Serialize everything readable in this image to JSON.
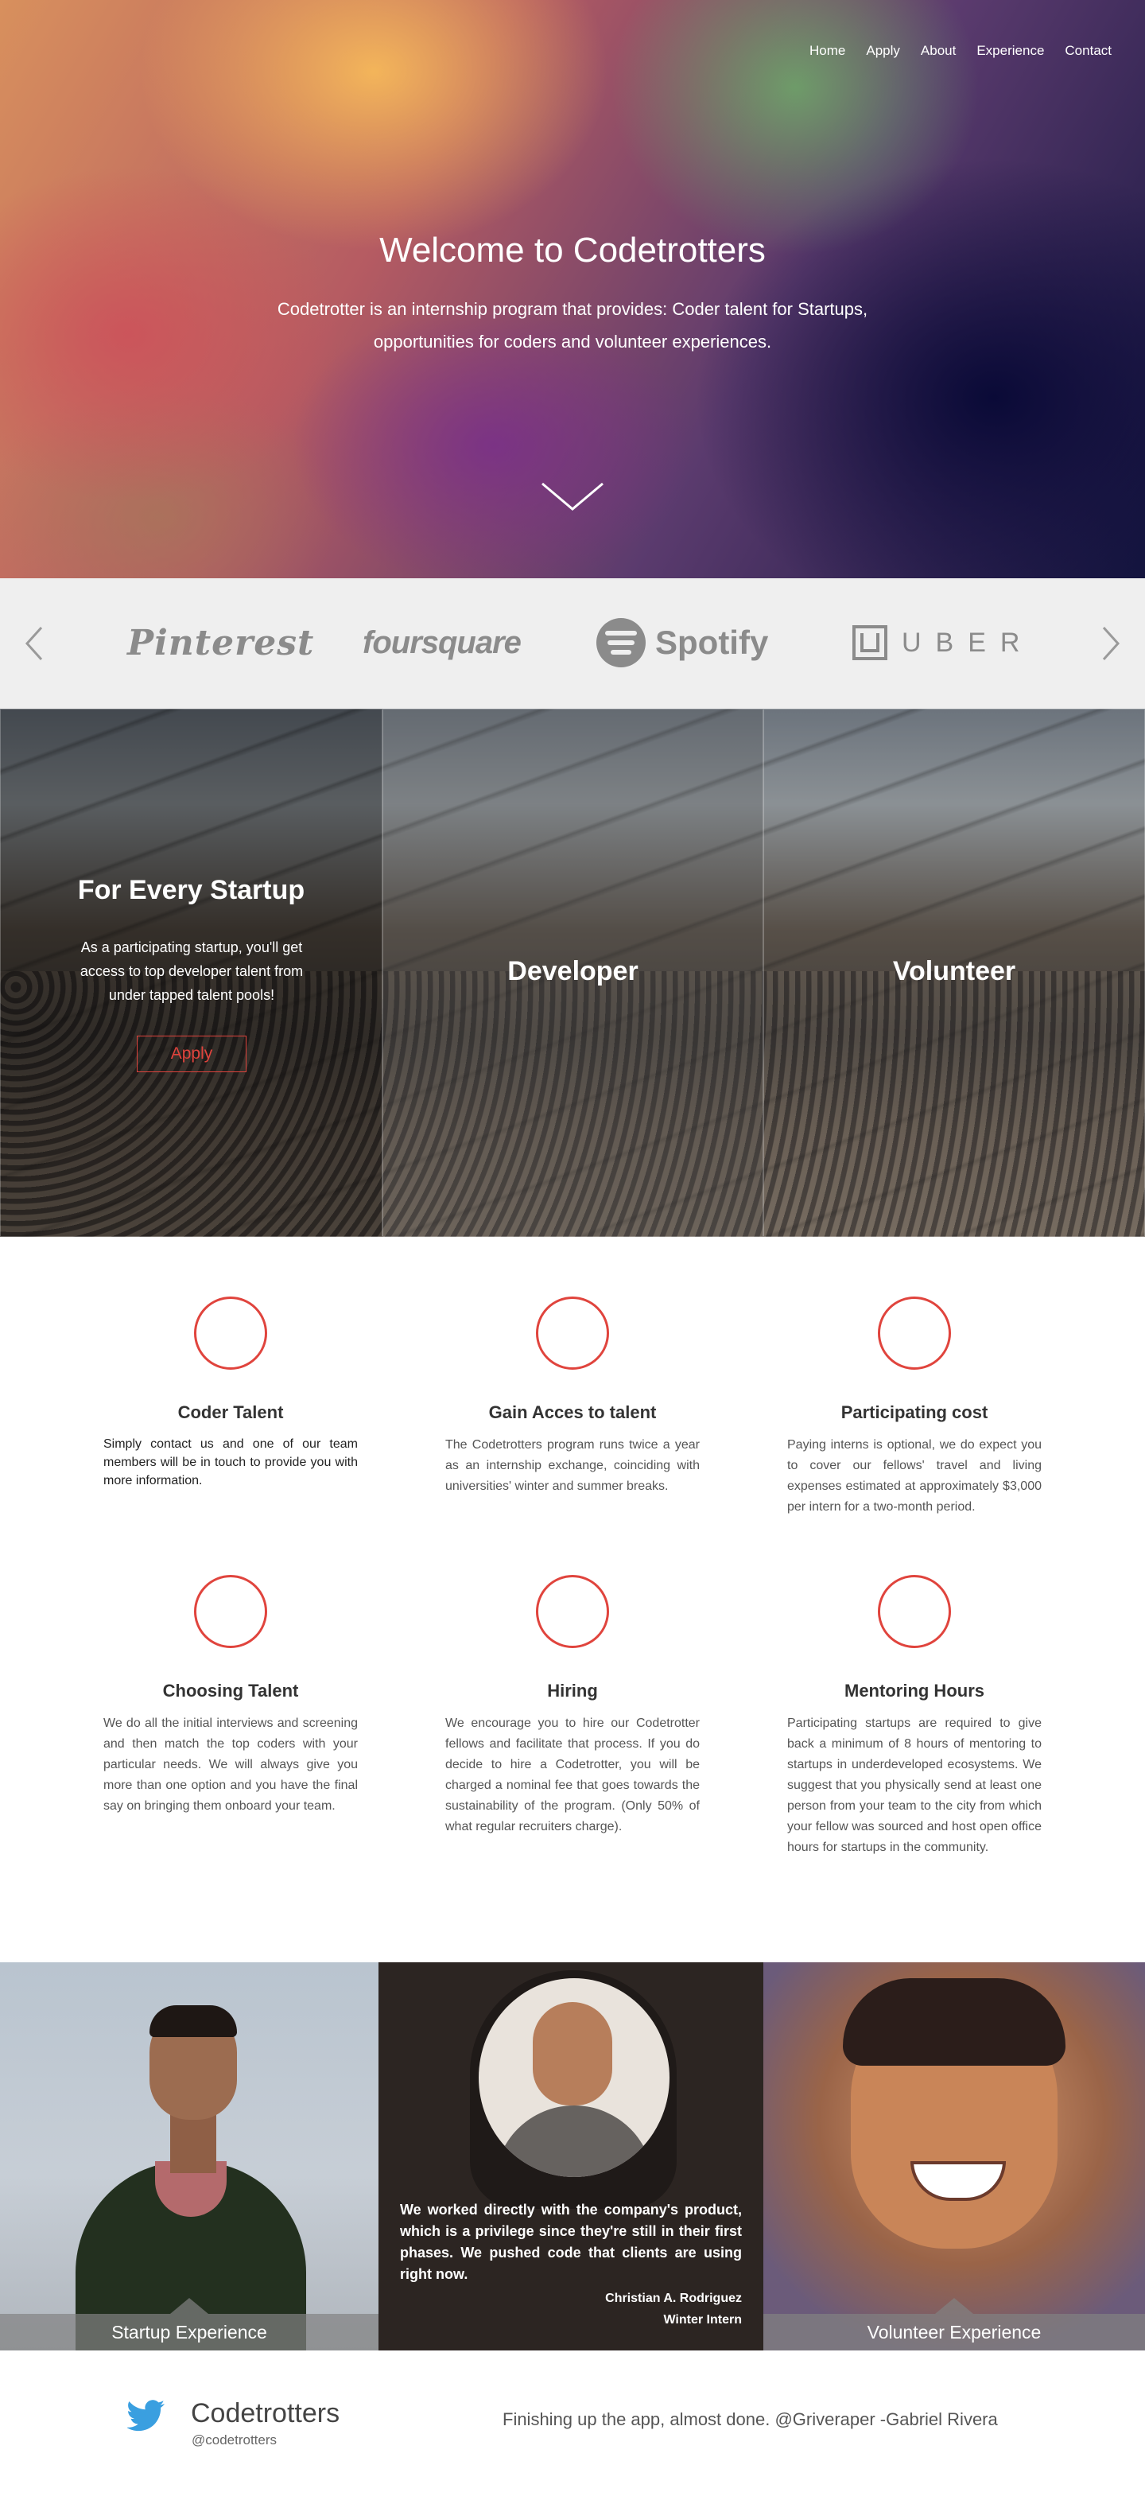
{
  "nav": {
    "items": [
      "Home",
      "Apply",
      "About",
      "Experience",
      "Contact"
    ]
  },
  "hero": {
    "title": "Welcome to Codetrotters",
    "subtitle": "Codetrotter is an internship program that provides: Coder talent for Startups, opportunities for coders and volunteer experiences."
  },
  "logos": {
    "pinterest": "Pinterest",
    "foursquare": "foursquare",
    "spotify": "Spotify",
    "uber": "UBER"
  },
  "panels": {
    "startup": {
      "title": "For Every Startup",
      "text": "As a participating startup, you'll get access to top developer talent from under tapped talent pools!",
      "button": "Apply"
    },
    "developer": {
      "title": "Developer"
    },
    "volunteer": {
      "title": "Volunteer"
    }
  },
  "features": [
    {
      "title": "Coder Talent",
      "text": "Simply contact us and one of our team members will be in touch to provide you with more information."
    },
    {
      "title": "Gain Acces to talent",
      "text": "The Codetrotters program runs twice a year as an internship exchange, coinciding with universities' winter and summer breaks."
    },
    {
      "title": "Participating cost",
      "text": "Paying interns is optional, we do expect you to cover our fellows' travel and living expenses estimated at approximately $3,000 per intern for a two-month period."
    },
    {
      "title": "Choosing Talent",
      "text": "We do all the initial interviews and screening and then match the top coders with your particular needs. We will always give you more than one option and you have the final say on bringing them onboard your team."
    },
    {
      "title": "Hiring",
      "text": "We encourage you to hire our Codetrotter fellows and facilitate that process. If you do decide to hire a Codetrotter, you will be charged a nominal fee that goes towards the sustainability of the program. (Only 50% of what regular recruiters charge)."
    },
    {
      "title": "Mentoring Hours",
      "text": "Participating startups are required to give back a minimum of 8 hours of mentoring to startups in underdeveloped ecosystems. We suggest that you physically send at least one person from your team to the city from which your fellow was sourced and host open office hours for startups in the community."
    }
  ],
  "testimonials": {
    "startup_caption": "Startup Experience",
    "quote": "We worked directly with the company's product, which is a privilege since they're still in their first phases. We pushed code that clients are using right now.",
    "name": "Christian A. Rodriguez",
    "role": "Winter Intern",
    "volunteer_caption": "Volunteer Experience"
  },
  "twitter": {
    "name": "Codetrotters",
    "handle": "@codetrotters",
    "tweet": "Finishing up the app, almost done. @Griveraper  -Gabriel Rivera"
  },
  "colors": {
    "accent": "#e0443d",
    "twitter": "#3a9fe0",
    "logo_gray": "#8b8b8b"
  }
}
